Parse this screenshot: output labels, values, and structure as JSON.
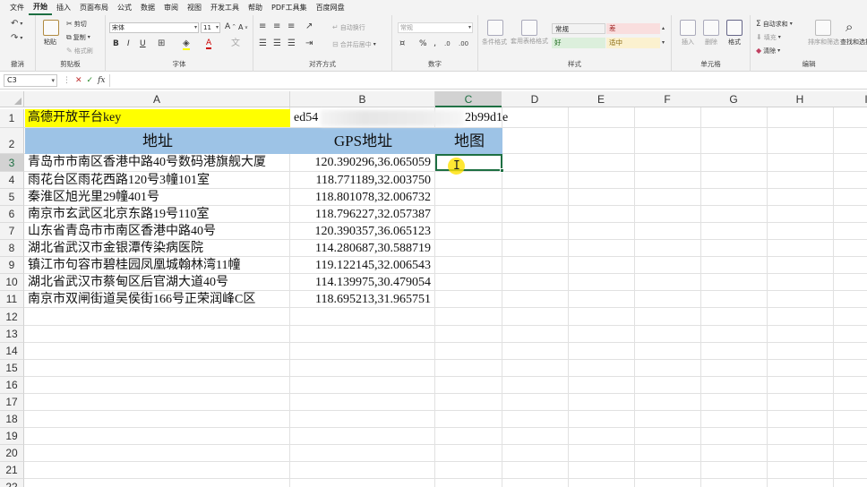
{
  "menu": {
    "tabs": [
      "文件",
      "开始",
      "插入",
      "页面布局",
      "公式",
      "数据",
      "审阅",
      "视图",
      "开发工具",
      "帮助",
      "PDF工具集",
      "百度网盘"
    ],
    "active": "开始"
  },
  "ribbon": {
    "undo": {
      "label": "撤消"
    },
    "clipboard": {
      "label": "剪贴板",
      "paste": "粘贴",
      "cut": "剪切",
      "copy": "复制",
      "format_painter": "格式刷"
    },
    "font": {
      "label": "字体",
      "name": "宋体",
      "size": "11",
      "bold": "B",
      "italic": "I",
      "underline": "U",
      "grow": "A",
      "shrink": "A",
      "font_color": "A"
    },
    "alignment": {
      "label": "对齐方式",
      "wrap": "自动换行",
      "merge": "合并后居中"
    },
    "number": {
      "label": "数字",
      "format": "常规",
      "percent": "%"
    },
    "styles": {
      "label": "样式",
      "conditional": "条件格式",
      "table": "套用表格格式",
      "normal": "常规",
      "bad": "差",
      "good": "好",
      "neutral": "适中"
    },
    "cells": {
      "label": "单元格",
      "insert": "插入",
      "delete": "删除",
      "format": "格式"
    },
    "editing": {
      "label": "编辑",
      "autosum": "自动求和",
      "fill": "填充",
      "clear": "清除",
      "sort": "排序和筛选",
      "find": "查找和选择"
    }
  },
  "formula_bar": {
    "name_box": "C3",
    "formula": "",
    "fx": "fx"
  },
  "columns": [
    "A",
    "B",
    "C",
    "D",
    "E",
    "F",
    "G",
    "H",
    "I"
  ],
  "selected_cell": {
    "col": "C",
    "row": 3
  },
  "rows": [
    "1",
    "2",
    "3",
    "4",
    "5",
    "6",
    "7",
    "8",
    "9",
    "10",
    "11",
    "12",
    "13",
    "14",
    "15",
    "16",
    "17",
    "18",
    "19",
    "20",
    "21",
    "22"
  ],
  "sheet": {
    "a1": "高德开放平台key",
    "b1_left": "ed54",
    "c1_right": "2b99d1e",
    "headers": [
      "地址",
      "GPS地址",
      "地图"
    ],
    "records": [
      {
        "address": "青岛市市南区香港中路40号数码港旗舰大厦",
        "gps": "120.390296,36.065059"
      },
      {
        "address": "雨花台区雨花西路120号3幢101室",
        "gps": "118.771189,32.003750"
      },
      {
        "address": "秦淮区旭光里29幢401号",
        "gps": "118.801078,32.006732"
      },
      {
        "address": "南京市玄武区北京东路19号110室",
        "gps": "118.796227,32.057387"
      },
      {
        "address": "山东省青岛市市南区香港中路40号",
        "gps": "120.390357,36.065123"
      },
      {
        "address": "湖北省武汉市金银潭传染病医院",
        "gps": "114.280687,30.588719"
      },
      {
        "address": "镇江市句容市碧桂园凤凰城翰林湾11幢",
        "gps": "119.122145,32.006543"
      },
      {
        "address": "湖北省武汉市蔡甸区后官湖大道40号",
        "gps": "114.139975,30.479054"
      },
      {
        "address": "南京市双闸街道吴侯街166号正荣润峰C区",
        "gps": "118.695213,31.965751"
      }
    ]
  },
  "colors": {
    "accent": "#1d6f42",
    "key_fill": "#ffff00",
    "header_fill": "#9dc3e6"
  }
}
